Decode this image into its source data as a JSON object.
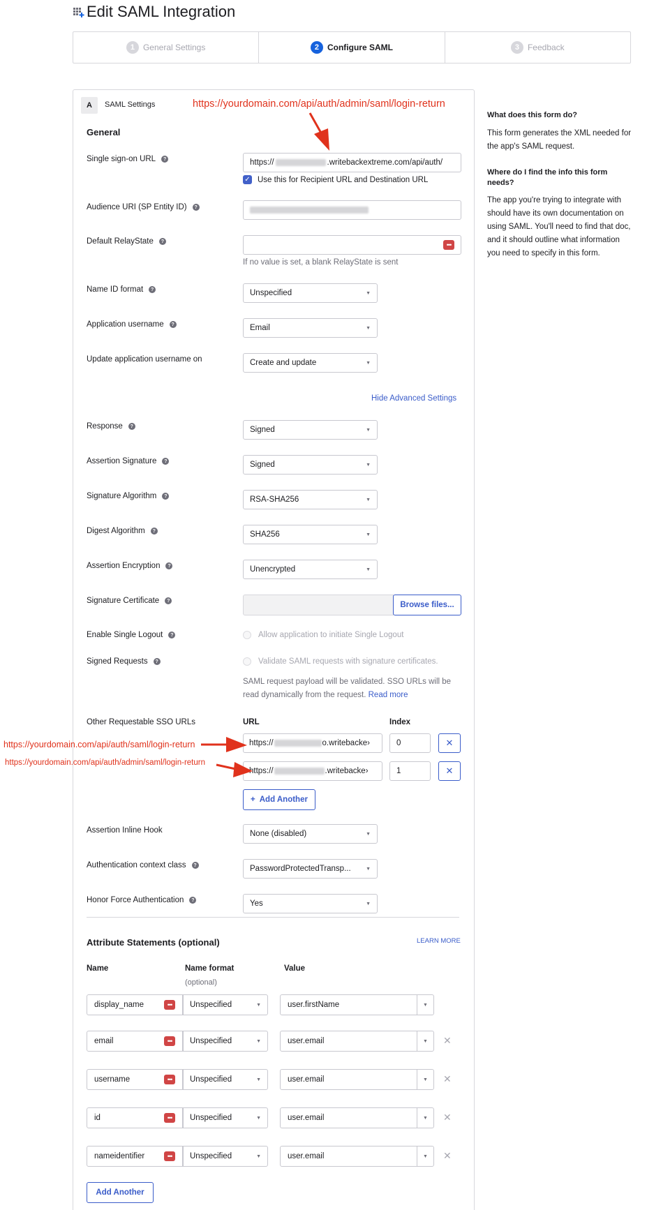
{
  "header": {
    "title": "Edit SAML Integration"
  },
  "steps": [
    {
      "num": "1",
      "label": "General Settings"
    },
    {
      "num": "2",
      "label": "Configure SAML"
    },
    {
      "num": "3",
      "label": "Feedback"
    }
  ],
  "card": {
    "letter": "A",
    "title": "SAML Settings",
    "section": "General"
  },
  "annotations": {
    "top": "https://yourdomain.com/api/auth/admin/saml/login-return",
    "sso1": "https://yourdomain.com/api/auth/saml/login-return",
    "sso2": "https://yourdomain.com/api/auth/admin/saml/login-return"
  },
  "fields": {
    "sso_url": {
      "label": "Single sign-on URL",
      "prefix": "https://",
      "suffix": ".writebackextreme.com/api/auth/",
      "checkbox_label": "Use this for Recipient URL and Destination URL"
    },
    "audience": {
      "label": "Audience URI (SP Entity ID)"
    },
    "relay": {
      "label": "Default RelayState",
      "hint": "If no value is set, a blank RelayState is sent"
    },
    "nameid": {
      "label": "Name ID format",
      "value": "Unspecified"
    },
    "app_username": {
      "label": "Application username",
      "value": "Email"
    },
    "update_on": {
      "label": "Update application username on",
      "value": "Create and update"
    },
    "hide_advanced": "Hide Advanced Settings",
    "response": {
      "label": "Response",
      "value": "Signed"
    },
    "assertion_sig": {
      "label": "Assertion Signature",
      "value": "Signed"
    },
    "sig_alg": {
      "label": "Signature Algorithm",
      "value": "RSA-SHA256"
    },
    "digest_alg": {
      "label": "Digest Algorithm",
      "value": "SHA256"
    },
    "assertion_enc": {
      "label": "Assertion Encryption",
      "value": "Unencrypted"
    },
    "sig_cert": {
      "label": "Signature Certificate",
      "button": "Browse files..."
    },
    "single_logout": {
      "label": "Enable Single Logout",
      "option": "Allow application to initiate Single Logout"
    },
    "signed_requests": {
      "label": "Signed Requests",
      "option": "Validate SAML requests with signature certificates.",
      "note1": "SAML request payload will be validated. SSO URLs will be",
      "note2": "read dynamically from the request.",
      "read_more": "Read more"
    },
    "other_sso": {
      "label": "Other Requestable SSO URLs",
      "col_url": "URL",
      "col_index": "Index",
      "rows": [
        {
          "prefix": "https://",
          "suffix": "o.writebacke›",
          "index": "0"
        },
        {
          "prefix": "https://",
          "suffix": ".writebacke›",
          "index": "1"
        }
      ],
      "add_button": "Add Another"
    },
    "inline_hook": {
      "label": "Assertion Inline Hook",
      "value": "None (disabled)"
    },
    "auth_context": {
      "label": "Authentication context class",
      "value": "PasswordProtectedTransp..."
    },
    "force_auth": {
      "label": "Honor Force Authentication",
      "value": "Yes"
    }
  },
  "attributes": {
    "title": "Attribute Statements (optional)",
    "learn_more": "LEARN MORE",
    "col_name": "Name",
    "col_format": "Name format",
    "col_format_sub": "(optional)",
    "col_value": "Value",
    "rows": [
      {
        "name": "display_name",
        "format": "Unspecified",
        "value": "user.firstName"
      },
      {
        "name": "email",
        "format": "Unspecified",
        "value": "user.email"
      },
      {
        "name": "username",
        "format": "Unspecified",
        "value": "user.email"
      },
      {
        "name": "id",
        "format": "Unspecified",
        "value": "user.email"
      },
      {
        "name": "nameidentifier",
        "format": "Unspecified",
        "value": "user.email"
      }
    ],
    "add_button": "Add Another"
  },
  "sidebar": {
    "q1": "What does this form do?",
    "a1": "This form generates the XML needed for the app's SAML request.",
    "q2": "Where do I find the info this form needs?",
    "a2": "The app you're trying to integrate with should have its own documentation on using SAML. You'll need to find that doc, and it should outline what information you need to specify in this form."
  },
  "colors": {
    "accent": "#1662dd",
    "link": "#3a5cc9",
    "annotation": "#e0321c",
    "danger": "#d04545"
  }
}
